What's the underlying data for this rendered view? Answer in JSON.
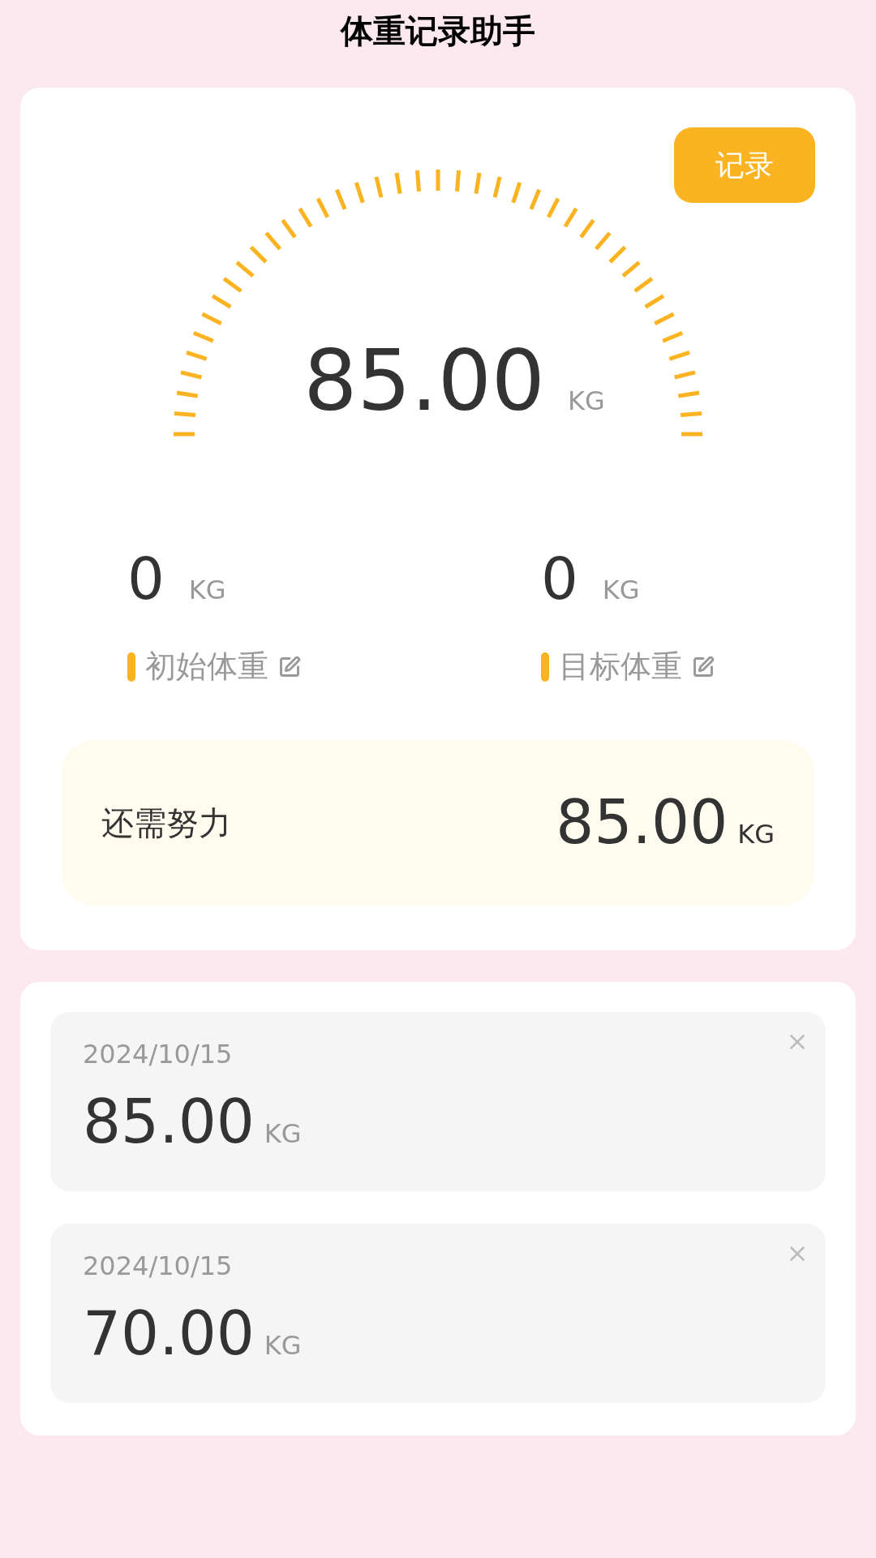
{
  "title": "体重记录助手",
  "record_button": "记录",
  "current": {
    "value": "85.00",
    "unit": "KG"
  },
  "stats": [
    {
      "value": "0",
      "unit": "KG",
      "label": "初始体重"
    },
    {
      "value": "0",
      "unit": "KG",
      "label": "目标体重"
    }
  ],
  "remaining": {
    "label": "还需努力",
    "value": "85.00",
    "unit": "KG"
  },
  "records": [
    {
      "date": "2024/10/15",
      "value": "85.00",
      "unit": "KG"
    },
    {
      "date": "2024/10/15",
      "value": "70.00",
      "unit": "KG"
    }
  ]
}
